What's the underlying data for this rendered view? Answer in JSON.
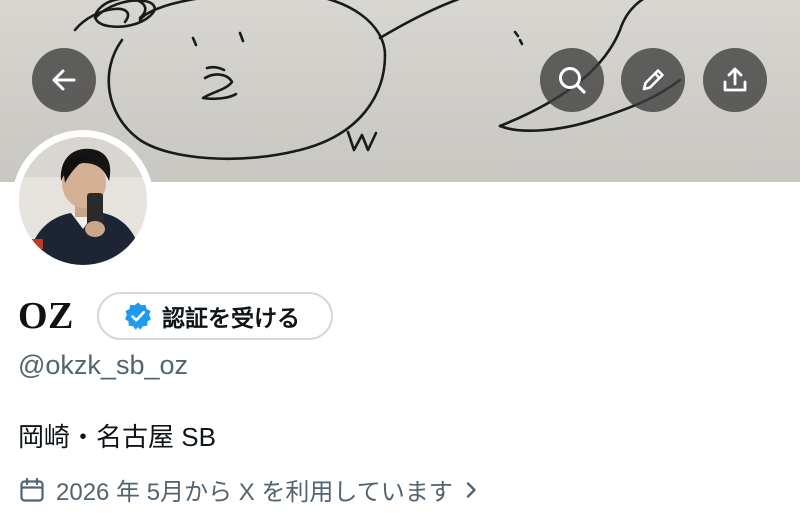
{
  "header": {
    "back_icon": "arrow-left-icon",
    "search_icon": "search-icon",
    "edit_icon": "pencil-icon",
    "share_icon": "share-upload-icon"
  },
  "profile": {
    "display_name": "OZ",
    "verify_label": "認証を受ける",
    "handle": "@okzk_sb_oz",
    "bio": "岡崎・名古屋 SB",
    "joined_text": "2026 年 5月から X を利用しています",
    "joined_icon": "calendar-icon",
    "joined_chevron": "chevron-right-icon"
  },
  "colors": {
    "verified_badge": "#1d9bf0",
    "secondary_text": "#536471",
    "primary_text": "#0f1419",
    "button_border": "#cfd9de"
  }
}
